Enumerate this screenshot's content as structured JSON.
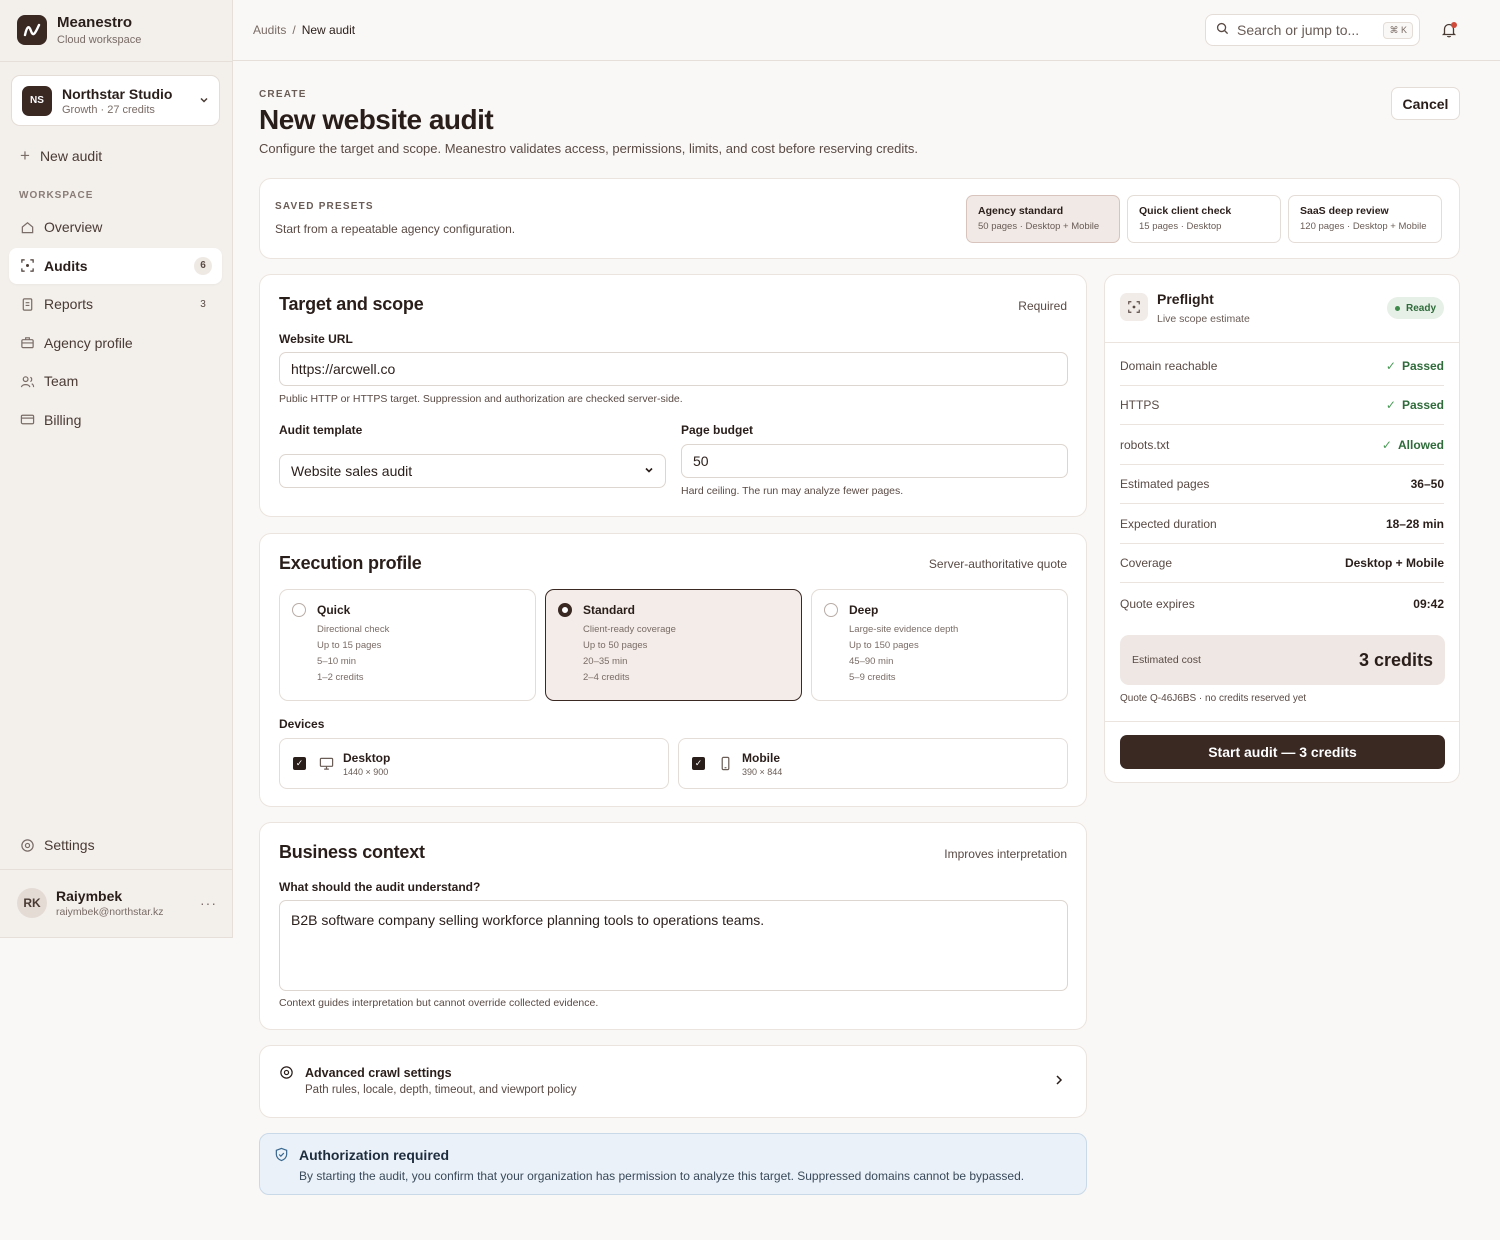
{
  "brand": {
    "name": "Meanestro",
    "subtitle": "Cloud workspace"
  },
  "org": {
    "initials": "NS",
    "name": "Northstar Studio",
    "meta": "Growth · 27 credits"
  },
  "sidebar": {
    "new_audit": "New audit",
    "section_label": "WORKSPACE",
    "items": [
      {
        "label": "Overview",
        "icon": "home-icon",
        "badge": ""
      },
      {
        "label": "Audits",
        "icon": "scan-icon",
        "badge": "6",
        "active": true
      },
      {
        "label": "Reports",
        "icon": "document-icon",
        "badge": "3"
      },
      {
        "label": "Agency profile",
        "icon": "briefcase-icon",
        "badge": ""
      },
      {
        "label": "Team",
        "icon": "users-icon",
        "badge": ""
      },
      {
        "label": "Billing",
        "icon": "card-icon",
        "badge": ""
      }
    ],
    "settings": "Settings"
  },
  "user": {
    "initials": "RK",
    "name": "Raiymbek",
    "email": "raiymbek@northstar.kz"
  },
  "topbar": {
    "breadcrumb": [
      "Audits",
      "New audit"
    ],
    "search_placeholder": "Search or jump to...",
    "search_shortcut": "⌘ K"
  },
  "header": {
    "eyebrow": "CREATE",
    "title": "New website audit",
    "subtitle": "Configure the target and scope. Meanestro validates access, permissions, limits, and cost before reserving credits.",
    "cancel": "Cancel"
  },
  "presets": {
    "label": "SAVED PRESETS",
    "description": "Start from a repeatable agency configuration.",
    "items": [
      {
        "name": "Agency standard",
        "meta": "50 pages · Desktop + Mobile",
        "active": true
      },
      {
        "name": "Quick client check",
        "meta": "15 pages · Desktop"
      },
      {
        "name": "SaaS deep review",
        "meta": "120 pages · Desktop + Mobile"
      }
    ]
  },
  "target": {
    "title": "Target and scope",
    "aside": "Required",
    "url_label": "Website URL",
    "url_value": "https://arcwell.co",
    "url_help": "Public HTTP or HTTPS target. Suppression and authorization are checked server-side.",
    "template_label": "Audit template",
    "template_value": "Website sales audit",
    "budget_label": "Page budget",
    "budget_value": "50",
    "budget_help": "Hard ceiling. The run may analyze fewer pages."
  },
  "execution": {
    "title": "Execution profile",
    "aside": "Server-authoritative quote",
    "options": [
      {
        "name": "Quick",
        "desc": "Directional check",
        "pages": "Up to 15 pages",
        "time": "5–10 min",
        "credits": "1–2 credits"
      },
      {
        "name": "Standard",
        "desc": "Client-ready coverage",
        "pages": "Up to 50 pages",
        "time": "20–35 min",
        "credits": "2–4 credits",
        "selected": true
      },
      {
        "name": "Deep",
        "desc": "Large-site evidence depth",
        "pages": "Up to 150 pages",
        "time": "45–90 min",
        "credits": "5–9 credits"
      }
    ],
    "devices_label": "Devices",
    "devices": [
      {
        "name": "Desktop",
        "size": "1440 × 900",
        "checked": true
      },
      {
        "name": "Mobile",
        "size": "390 × 844",
        "checked": true
      }
    ]
  },
  "business": {
    "title": "Business context",
    "aside": "Improves interpretation",
    "question": "What should the audit understand?",
    "value": "B2B software company selling workforce planning tools to operations teams.",
    "help": "Context guides interpretation but cannot override collected evidence."
  },
  "advanced": {
    "title": "Advanced crawl settings",
    "subtitle": "Path rules, locale, depth, timeout, and viewport policy"
  },
  "auth": {
    "title": "Authorization required",
    "text": "By starting the audit, you confirm that your organization has permission to analyze this target. Suppressed domains cannot be bypassed."
  },
  "preflight": {
    "title": "Preflight",
    "subtitle": "Live scope estimate",
    "status": "Ready",
    "rows": [
      {
        "key": "Domain reachable",
        "value": "Passed",
        "ok": true
      },
      {
        "key": "HTTPS",
        "value": "Passed",
        "ok": true
      },
      {
        "key": "robots.txt",
        "value": "Allowed",
        "ok": true
      },
      {
        "key": "Estimated pages",
        "value": "36–50"
      },
      {
        "key": "Expected duration",
        "value": "18–28 min"
      },
      {
        "key": "Coverage",
        "value": "Desktop + Mobile"
      },
      {
        "key": "Quote expires",
        "value": "09:42"
      }
    ],
    "cost_label": "Estimated cost",
    "cost_value": "3 credits",
    "quote_note": "Quote Q-46J6BS · no credits reserved yet",
    "start": "Start audit — 3 credits"
  },
  "colors": {
    "brand": "#3a2823",
    "success": "#2f6b3a",
    "info_bg": "#eaf1f8"
  }
}
